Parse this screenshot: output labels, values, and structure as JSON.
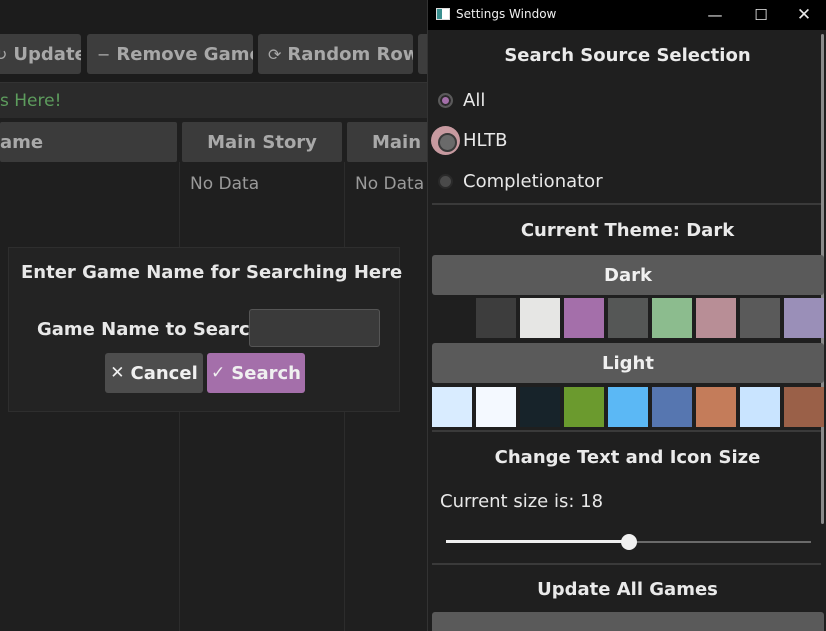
{
  "main_app": {
    "toolbar": {
      "update_icon": "↻",
      "update_label": "Update",
      "remove_icon": "−",
      "remove_label": "Remove Game",
      "random_icon": "⟳",
      "random_label": "Random Row"
    },
    "search_placeholder": "s Here!",
    "columns": [
      "ame",
      "Main Story",
      "Main -"
    ],
    "cells": [
      "No Data",
      "No Data"
    ]
  },
  "dialog": {
    "title": "Enter Game Name for Searching Here",
    "field_label": "Game Name to Search",
    "field_value": "",
    "cancel_icon": "✕",
    "cancel_label": "Cancel",
    "search_icon": "✓",
    "search_label": "Search"
  },
  "settings": {
    "window_title": "Settings Window",
    "controls": {
      "minimize": "—",
      "maximize": "☐",
      "close": "✕"
    },
    "search_source": {
      "title": "Search Source Selection",
      "options": [
        {
          "label": "All",
          "selected": true
        },
        {
          "label": "HLTB",
          "selected": false
        },
        {
          "label": "Completionator",
          "selected": false
        }
      ]
    },
    "theme": {
      "title": "Current Theme: Dark",
      "dark_label": "Dark",
      "dark_swatches": [
        "#1f1f1f",
        "#3d3d3d",
        "#e6e6e4",
        "#a46faa",
        "#555756",
        "#8cbc8e",
        "#b88e96",
        "#5a5a5a",
        "#9a8fb8"
      ],
      "light_label": "Light",
      "light_swatches": [
        "#d9ecff",
        "#f4f9ff",
        "#17232a",
        "#6b9a2e",
        "#5bb8f5",
        "#5676b0",
        "#c47c5a",
        "#c9e4ff",
        "#9a6048"
      ]
    },
    "size": {
      "title": "Change Text and Icon Size",
      "current_text": "Current size is: 18",
      "slider_fraction": 0.5
    },
    "update_all": {
      "title": "Update All Games"
    },
    "colors": {
      "accent": "#a46faa",
      "background": "#1f1f1f",
      "button": "#5a5a5a"
    }
  }
}
